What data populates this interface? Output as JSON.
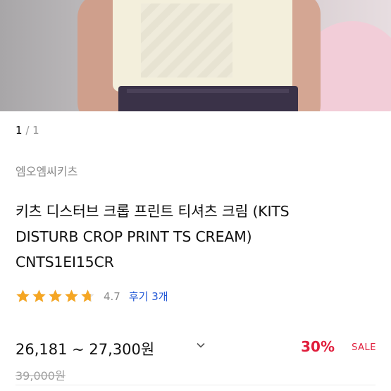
{
  "gallery": {
    "current": "1",
    "separator": "/",
    "total": "1"
  },
  "product": {
    "brand": "엠오엠씨키츠",
    "title_line1": "키츠 디스터브 크롭 프린트 티셔츠 크림 (KITS",
    "title_line2": "DISTURB CROP PRINT TS CREAM)",
    "title_line3": "CNTS1EI15CR"
  },
  "rating": {
    "stars": 4.7,
    "score_label": "4.7",
    "reviews_label": "후기 3개"
  },
  "price": {
    "range": "26,181 ~ 27,300원",
    "discount": "30%",
    "sale_label": "SALE",
    "original": "39,000원"
  },
  "colors": {
    "star": "#f5a623",
    "discount": "#e01e3c",
    "link": "#2157d6"
  },
  "icons": {
    "star": "star-icon",
    "chevron": "chevron-down-icon"
  }
}
